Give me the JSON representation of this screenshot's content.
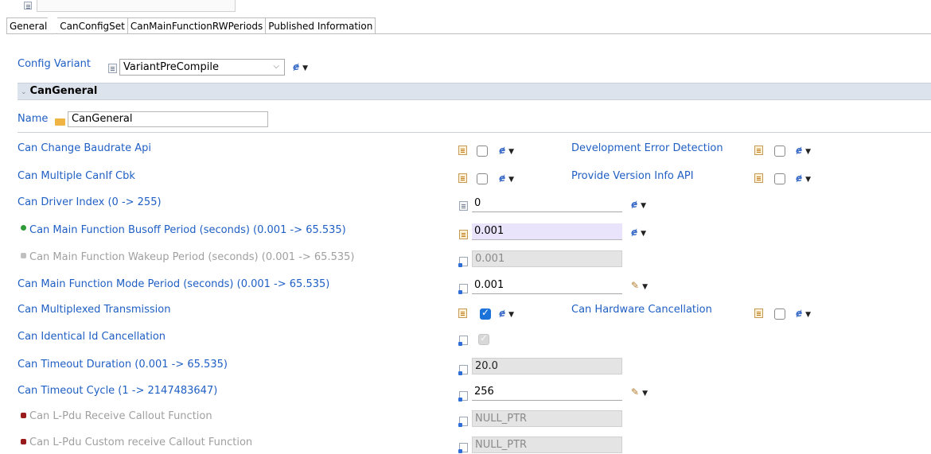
{
  "tabs": [
    {
      "label": "General",
      "active": true
    },
    {
      "label": "CanConfigSet"
    },
    {
      "label": "CanMainFunctionRWPeriods"
    },
    {
      "label": "Published Information"
    }
  ],
  "config_variant": {
    "label": "Config Variant",
    "value": "VariantPreCompile"
  },
  "section": {
    "title": "CanGeneral"
  },
  "name_field": {
    "label": "Name",
    "value": "CanGeneral"
  },
  "params": {
    "change_baudrate": {
      "label": "Can Change Baudrate Api",
      "checked": false
    },
    "dev_error": {
      "label": "Development Error Detection",
      "checked": false
    },
    "multiple_canif": {
      "label": "Can Multiple CanIf Cbk",
      "checked": false
    },
    "version_info": {
      "label": "Provide Version Info API",
      "checked": false
    },
    "driver_index": {
      "label": "Can Driver Index (0 -> 255)",
      "value": "0"
    },
    "busoff_period": {
      "label": "Can Main Function Busoff Period (seconds) (0.001 -> 65.535)",
      "value": "0.001"
    },
    "wakeup_period": {
      "label": "Can Main Function Wakeup Period (seconds) (0.001 -> 65.535)",
      "value": "0.001"
    },
    "mode_period": {
      "label": "Can Main Function Mode Period (seconds) (0.001 -> 65.535)",
      "value": "0.001"
    },
    "multiplexed": {
      "label": "Can Multiplexed Transmission",
      "checked": true
    },
    "hw_cancel": {
      "label": "Can Hardware Cancellation",
      "checked": false
    },
    "identical_id": {
      "label": "Can Identical Id Cancellation",
      "checked": true
    },
    "timeout_duration": {
      "label": "Can Timeout Duration (0.001 -> 65.535)",
      "value": "20.0"
    },
    "timeout_cycle": {
      "label": "Can Timeout Cycle (1 -> 2147483647)",
      "value": "256"
    },
    "lpdu_receive": {
      "label": "Can L-Pdu Receive Callout Function",
      "value": "NULL_PTR"
    },
    "lpdu_custom": {
      "label": "Can L-Pdu Custom receive Callout Function",
      "value": "NULL_PTR"
    }
  },
  "colors": {
    "label_blue": "#1f5fc4",
    "section_bg": "#dde3ec",
    "checkbox_on": "#1b72d9",
    "busoff_field": "#e9e4fb"
  }
}
